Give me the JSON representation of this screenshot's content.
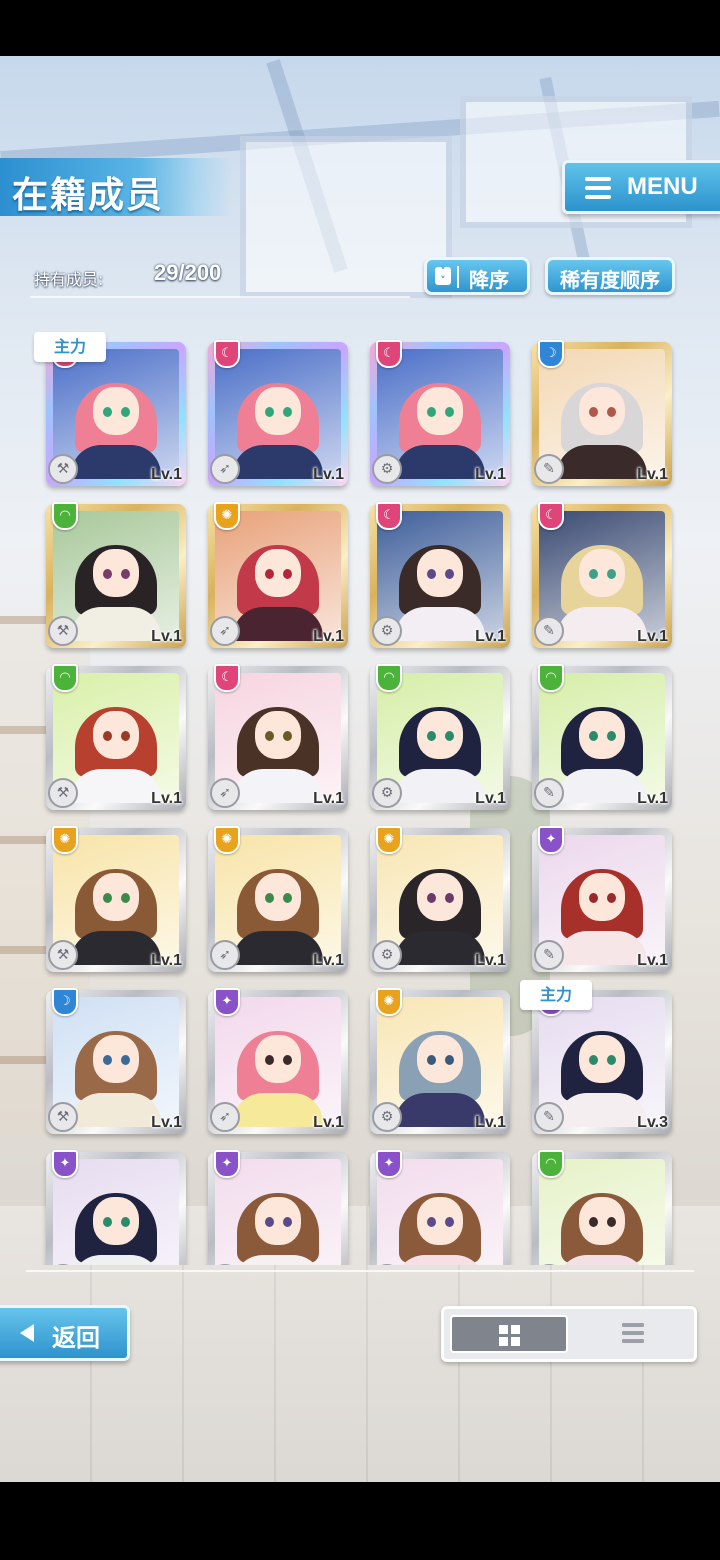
{
  "header": {
    "title": "在籍成员",
    "menu_label": "MENU"
  },
  "summary": {
    "owned_label": "持有成员:",
    "owned_value": "29/200"
  },
  "sort": {
    "direction_label": "降序",
    "type_label": "稀有度顺序"
  },
  "main_tag": "主力",
  "cards": [
    {
      "frame": "rainbow",
      "attr": "pink",
      "level": "Lv.1",
      "hair": "#ef7f95",
      "eye": "#2fa77a",
      "cloth": "#2b3a6a",
      "bg": "#4b6fc8",
      "main": true
    },
    {
      "frame": "rainbow",
      "attr": "pink",
      "level": "Lv.1",
      "hair": "#ef7f95",
      "eye": "#2fa77a",
      "cloth": "#2b3a6a",
      "bg": "#4b6fc8"
    },
    {
      "frame": "rainbow",
      "attr": "pink",
      "level": "Lv.1",
      "hair": "#ef7f95",
      "eye": "#2fa77a",
      "cloth": "#2b3a6a",
      "bg": "#4b6fc8"
    },
    {
      "frame": "gold",
      "attr": "blue",
      "level": "Lv.1",
      "hair": "#d9d6d8",
      "eye": "#b0584a",
      "cloth": "#3a2a2a",
      "bg": "#f3d8b4"
    },
    {
      "frame": "gold",
      "attr": "green",
      "level": "Lv.1",
      "hair": "#2a2326",
      "eye": "#7a3b6a",
      "cloth": "#f1eee4",
      "bg": "#a8c89a"
    },
    {
      "frame": "gold",
      "attr": "yellow",
      "level": "Lv.1",
      "hair": "#c2394a",
      "eye": "#b2283a",
      "cloth": "#4a2430",
      "bg": "#e8a27a"
    },
    {
      "frame": "gold",
      "attr": "pink",
      "level": "Lv.1",
      "hair": "#3b2b28",
      "eye": "#5b4a8a",
      "cloth": "#f3eef4",
      "bg": "#3f5f9a"
    },
    {
      "frame": "gold",
      "attr": "pink",
      "level": "Lv.1",
      "hair": "#e6d49a",
      "eye": "#3fa08a",
      "cloth": "#f4ecef",
      "bg": "#3a4a72"
    },
    {
      "frame": "silver",
      "attr": "green",
      "level": "Lv.1",
      "hair": "#b8402e",
      "eye": "#9a3a22",
      "cloth": "#f6f6f8",
      "bg": "#d9f0a8"
    },
    {
      "frame": "silver",
      "attr": "pink",
      "level": "Lv.1",
      "hair": "#4a3226",
      "eye": "#6a5a26",
      "cloth": "#f4f4f8",
      "bg": "#f6d4e0"
    },
    {
      "frame": "silver",
      "attr": "green",
      "level": "Lv.1",
      "hair": "#1f2340",
      "eye": "#2a8a6a",
      "cloth": "#f2f2f6",
      "bg": "#d6eea8"
    },
    {
      "frame": "silver",
      "attr": "green",
      "level": "Lv.1",
      "hair": "#1f2340",
      "eye": "#2a8a6a",
      "cloth": "#f2f2f6",
      "bg": "#d6eea8"
    },
    {
      "frame": "silver",
      "attr": "yellow",
      "level": "Lv.1",
      "hair": "#8a5a36",
      "eye": "#3a8a4a",
      "cloth": "#2a2a30",
      "bg": "#f8e4a8"
    },
    {
      "frame": "silver",
      "attr": "yellow",
      "level": "Lv.1",
      "hair": "#8a5a36",
      "eye": "#3a8a4a",
      "cloth": "#2a2a30",
      "bg": "#f8e4a8"
    },
    {
      "frame": "silver",
      "attr": "yellow",
      "level": "Lv.1",
      "hair": "#2a2528",
      "eye": "#6a3a6a",
      "cloth": "#2a2a30",
      "bg": "#f8e6b4"
    },
    {
      "frame": "silver",
      "attr": "purple",
      "level": "Lv.1",
      "hair": "#a8302a",
      "eye": "#9a2a2a",
      "cloth": "#f6e6e8",
      "bg": "#ecd8ec"
    },
    {
      "frame": "silver",
      "attr": "blue",
      "level": "Lv.1",
      "hair": "#9a6a48",
      "eye": "#3a6a9a",
      "cloth": "#f2ead8",
      "bg": "#cfe0f4"
    },
    {
      "frame": "silver",
      "attr": "purple",
      "level": "Lv.1",
      "hair": "#ef7f95",
      "eye": "#3a2a2a",
      "cloth": "#f7e99a",
      "bg": "#f2d8ec"
    },
    {
      "frame": "silver",
      "attr": "yellow",
      "level": "Lv.1",
      "hair": "#8aa0b4",
      "eye": "#3a5a7a",
      "cloth": "#3a3a6a",
      "bg": "#f8e6b4"
    },
    {
      "frame": "silver",
      "attr": "purple",
      "level": "Lv.3",
      "hair": "#1f2340",
      "eye": "#2a8a6a",
      "cloth": "#f4eef0",
      "bg": "#e6dcf0",
      "main": true
    },
    {
      "frame": "silver",
      "attr": "purple",
      "level": "",
      "hair": "#1f2340",
      "eye": "#2a8a6a",
      "cloth": "#eef0f2",
      "bg": "#e6dcf0"
    },
    {
      "frame": "silver",
      "attr": "purple",
      "level": "",
      "hair": "#8a5a3a",
      "eye": "#5a4a8a",
      "cloth": "#f6f0f0",
      "bg": "#f2dcec"
    },
    {
      "frame": "silver",
      "attr": "purple",
      "level": "",
      "hair": "#8a5a3a",
      "eye": "#5a4a8a",
      "cloth": "#f6e0e6",
      "bg": "#f2dcec"
    },
    {
      "frame": "silver",
      "attr": "green",
      "level": "",
      "hair": "#8a5a3a",
      "eye": "#3a2a2a",
      "cloth": "#f2e0e6",
      "bg": "#e6f2c8"
    }
  ],
  "footer": {
    "back_label": "返回"
  },
  "colors": {
    "accent": "#2f95cf",
    "attr_pink": "#e0457a",
    "attr_blue": "#2f86d6",
    "attr_green": "#4bb33a",
    "attr_yellow": "#e8a21c",
    "attr_purple": "#8a52c8"
  }
}
